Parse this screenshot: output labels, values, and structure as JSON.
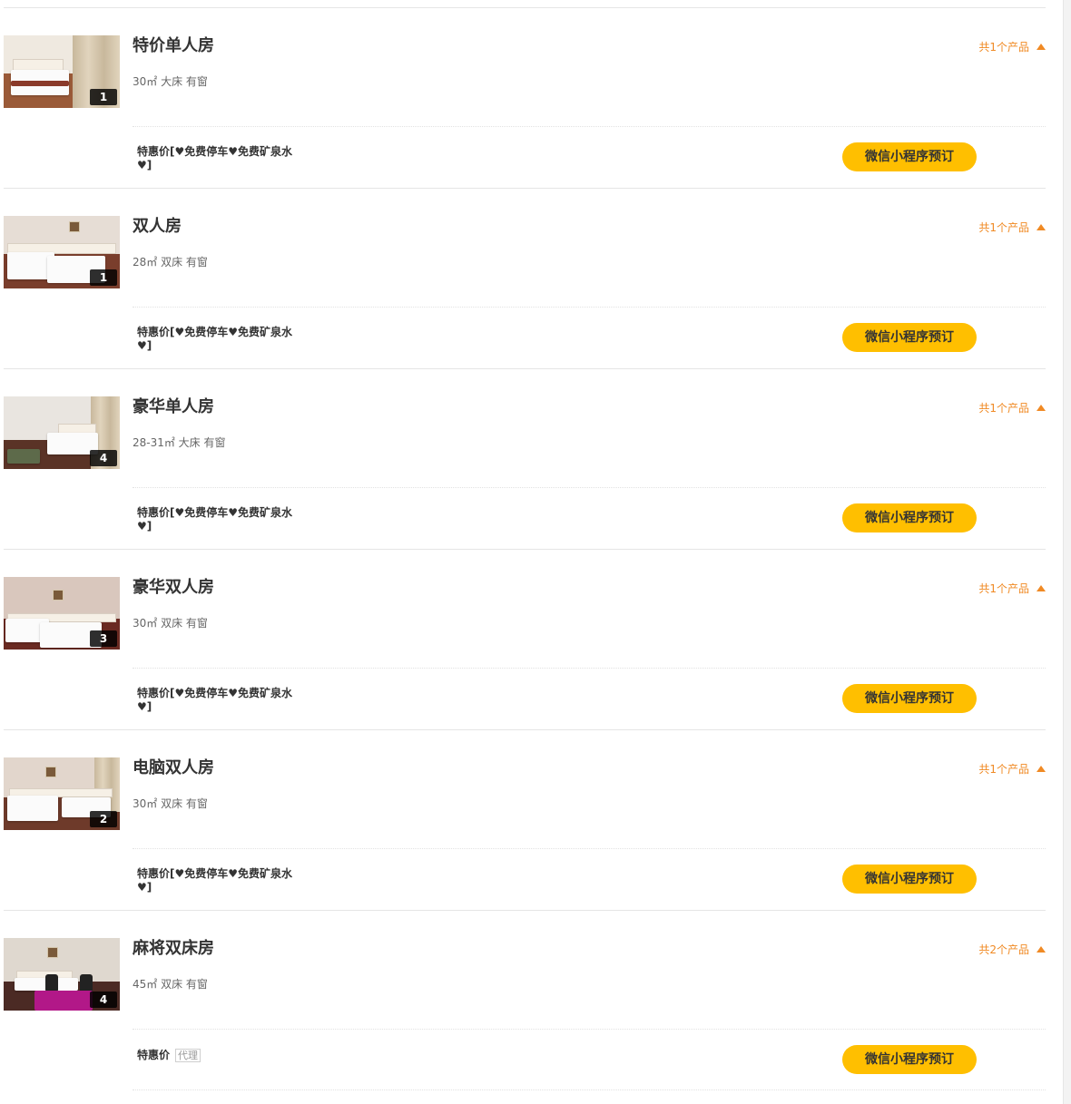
{
  "colors": {
    "accent_orange": "#f08a24",
    "book_button_bg": "#ffbf00",
    "divider": "#e5e5e5"
  },
  "book_button_label": "微信小程序预订",
  "rooms": [
    {
      "name": "特价单人房",
      "meta": "30㎡ 大床 有窗",
      "photo_count": "1",
      "product_count": "共1个产品",
      "offer": "特惠价[♥免费停车♥免费矿泉水♥]",
      "icon": "single-bed-room-photo"
    },
    {
      "name": "双人房",
      "meta": "28㎡ 双床 有窗",
      "photo_count": "1",
      "product_count": "共1个产品",
      "offer": "特惠价[♥免费停车♥免费矿泉水♥]",
      "icon": "twin-bed-room-photo"
    },
    {
      "name": "豪华单人房",
      "meta": "28-31㎡ 大床 有窗",
      "photo_count": "4",
      "product_count": "共1个产品",
      "offer": "特惠价[♥免费停车♥免费矿泉水♥]",
      "icon": "deluxe-single-room-photo"
    },
    {
      "name": "豪华双人房",
      "meta": "30㎡ 双床 有窗",
      "photo_count": "3",
      "product_count": "共1个产品",
      "offer": "特惠价[♥免费停车♥免费矿泉水♥]",
      "icon": "deluxe-twin-room-photo"
    },
    {
      "name": "电脑双人房",
      "meta": "30㎡ 双床 有窗",
      "photo_count": "2",
      "product_count": "共1个产品",
      "offer": "特惠价[♥免费停车♥免费矿泉水♥]",
      "icon": "computer-twin-room-photo"
    },
    {
      "name": "麻将双床房",
      "meta": "45㎡ 双床 有窗",
      "photo_count": "4",
      "product_count": "共2个产品",
      "offer": "特惠价",
      "offer_tag": "代理",
      "icon": "mahjong-twin-room-photo"
    }
  ]
}
